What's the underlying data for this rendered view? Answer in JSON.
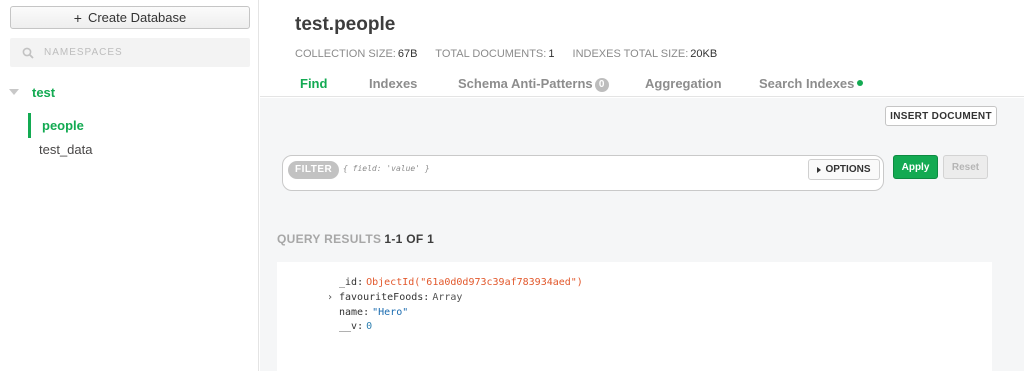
{
  "sidebar": {
    "create_database_label": "Create Database",
    "namespace_placeholder": "NAMESPACES",
    "database": "test",
    "collections": [
      "people",
      "test_data"
    ]
  },
  "header": {
    "title": "test.people",
    "stats": [
      {
        "label": "COLLECTION SIZE:",
        "value": "67B"
      },
      {
        "label": "TOTAL DOCUMENTS:",
        "value": "1"
      },
      {
        "label": "INDEXES TOTAL SIZE:",
        "value": "20KB"
      }
    ],
    "tabs": [
      {
        "label": "Find",
        "active": true
      },
      {
        "label": "Indexes"
      },
      {
        "label": "Schema Anti-Patterns",
        "badge": "0"
      },
      {
        "label": "Aggregation"
      },
      {
        "label": "Search Indexes",
        "dot": true
      }
    ]
  },
  "toolbar": {
    "insert_document_label": "INSERT DOCUMENT"
  },
  "filter": {
    "label": "FILTER",
    "placeholder": "{ field: 'value' }",
    "options_label": "OPTIONS",
    "apply_label": "Apply",
    "reset_label": "Reset"
  },
  "results": {
    "label": "QUERY RESULTS",
    "count": "1-1 OF 1"
  },
  "document": {
    "fields": [
      {
        "key": "_id",
        "value": "ObjectId(\"61a0d0d973c39af783934aed\")",
        "kind": "oid"
      },
      {
        "key": "favouriteFoods",
        "value": "Array",
        "kind": "type",
        "expandable": true
      },
      {
        "key": "name",
        "value": "\"Hero\"",
        "kind": "str"
      },
      {
        "key": "__v",
        "value": "0",
        "kind": "num"
      }
    ]
  },
  "colors": {
    "accent": "#13aa52",
    "oid": "#e2582c",
    "string": "#1a6bb0"
  }
}
